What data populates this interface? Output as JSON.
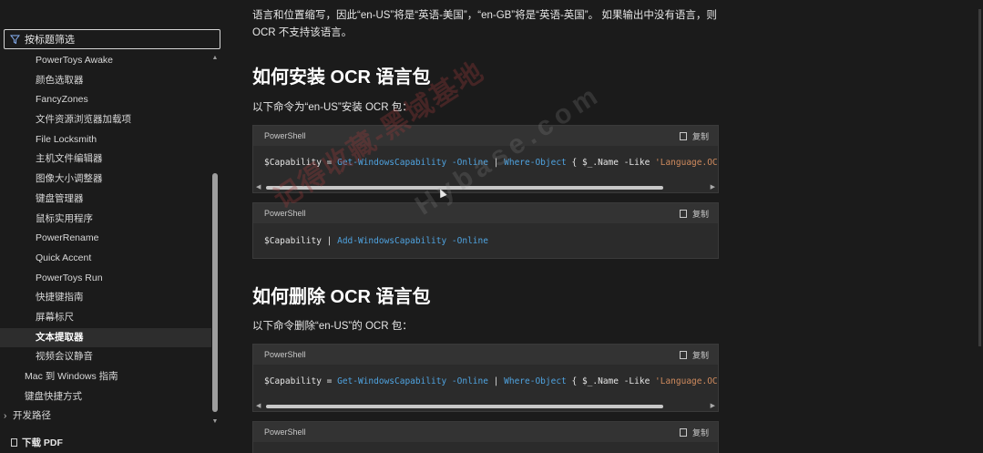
{
  "sidebar": {
    "filter_label": "按标题筛选",
    "items": [
      {
        "label": "PowerToys Awake",
        "level": 2
      },
      {
        "label": "颜色选取器",
        "level": 2
      },
      {
        "label": "FancyZones",
        "level": 2
      },
      {
        "label": "文件资源浏览器加载项",
        "level": 2
      },
      {
        "label": "File Locksmith",
        "level": 2
      },
      {
        "label": "主机文件编辑器",
        "level": 2
      },
      {
        "label": "图像大小调整器",
        "level": 2
      },
      {
        "label": "键盘管理器",
        "level": 2
      },
      {
        "label": "鼠标实用程序",
        "level": 2
      },
      {
        "label": "PowerRename",
        "level": 2
      },
      {
        "label": "Quick Accent",
        "level": 2
      },
      {
        "label": "PowerToys Run",
        "level": 2
      },
      {
        "label": "快捷键指南",
        "level": 2
      },
      {
        "label": "屏幕标尺",
        "level": 2
      },
      {
        "label": "文本提取器",
        "level": 2,
        "active": true
      },
      {
        "label": "视频会议静音",
        "level": 2
      },
      {
        "label": "Mac 到 Windows 指南",
        "level": 1
      },
      {
        "label": "键盘快捷方式",
        "level": 1
      },
      {
        "label": "开发路径",
        "level": 0
      }
    ],
    "download_label": "下载 PDF"
  },
  "content": {
    "top_text": "语言和位置缩写，因此“en-US”将是“英语-美国”，“en-GB”将是“英语-英国”。 如果输出中没有语言，则 OCR 不支持该语言。",
    "install_heading": "如何安装 OCR 语言包",
    "install_intro": "以下命令为“en-US”安装 OCR 包：",
    "remove_heading": "如何删除 OCR 语言包",
    "remove_intro": "以下命令删除“en-US”的 OCR 包：",
    "code_lang": "PowerShell",
    "copy_label": "复制",
    "code1": {
      "var": "$Capability",
      "eq": " = ",
      "cmd1": "Get-WindowsCapability",
      "par1": " -Online",
      "pipe": " | ",
      "cmd2": "Where-Object",
      "rest": " { $_.Name -Like ",
      "str": "'Language.OCR"
    },
    "code2": {
      "var": "$Capability",
      "pipe": " | ",
      "cmd": "Add-WindowsCapability",
      "par": " -Online"
    },
    "code3": {
      "var": "$Capability",
      "eq": " = ",
      "cmd1": "Get-WindowsCapability",
      "par1": " -Online",
      "pipe": " | ",
      "cmd2": "Where-Object",
      "rest": " { $_.Name -Like ",
      "str": "'Language.OCR"
    }
  },
  "watermark": {
    "text1": "记得收藏-黑域基地",
    "text2": "Hybase.com"
  },
  "colors": {
    "background": "#1b1b1b",
    "code_bg": "#2b2b2b",
    "keyword_blue": "#4fa3e0",
    "string_orange": "#d08b5e"
  }
}
